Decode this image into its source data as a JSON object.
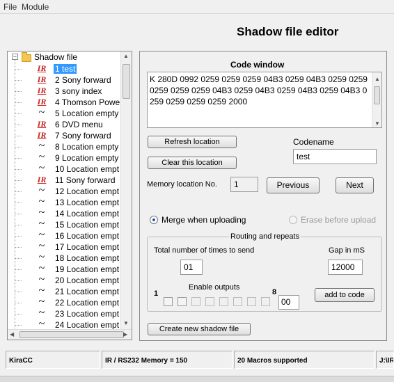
{
  "menu": {
    "file": "File",
    "module": "Module"
  },
  "title": "Shadow file editor",
  "tree": {
    "root_label": "Shadow file",
    "items": [
      {
        "type": "ir",
        "label": "1 test",
        "selected": true
      },
      {
        "type": "ir",
        "label": "2 Sony forward"
      },
      {
        "type": "ir",
        "label": "3 sony index"
      },
      {
        "type": "ir",
        "label": "4 Thomson Powe"
      },
      {
        "type": "empty",
        "label": "5 Location empty"
      },
      {
        "type": "ir",
        "label": "6 DVD menu"
      },
      {
        "type": "ir",
        "label": "7 Sony forward"
      },
      {
        "type": "empty",
        "label": "8 Location empty"
      },
      {
        "type": "empty",
        "label": "9 Location empty"
      },
      {
        "type": "empty",
        "label": "10 Location empt"
      },
      {
        "type": "ir",
        "label": "11 Sony forward"
      },
      {
        "type": "empty",
        "label": "12 Location empt"
      },
      {
        "type": "empty",
        "label": "13 Location empt"
      },
      {
        "type": "empty",
        "label": "14 Location empt"
      },
      {
        "type": "empty",
        "label": "15 Location empt"
      },
      {
        "type": "empty",
        "label": "16 Location empt"
      },
      {
        "type": "empty",
        "label": "17 Location empt"
      },
      {
        "type": "empty",
        "label": "18 Location empt"
      },
      {
        "type": "empty",
        "label": "19 Location empt"
      },
      {
        "type": "empty",
        "label": "20 Location empt"
      },
      {
        "type": "empty",
        "label": "21 Location empt"
      },
      {
        "type": "empty",
        "label": "22 Location empt"
      },
      {
        "type": "empty",
        "label": "23 Location empt"
      },
      {
        "type": "empty",
        "label": "24 Location empt"
      }
    ],
    "ir_glyph": "IR",
    "empty_glyph": "~"
  },
  "code_window": {
    "label": "Code window",
    "text": "K 280D 0992 0259 0259 0259 04B3 0259 04B3 0259 0259 0259 0259 0259 04B3 0259 04B3 0259 04B3 0259 04B3 0259 0259 0259 0259 2000"
  },
  "buttons": {
    "refresh": "Refresh location",
    "clear": "Clear this location",
    "previous": "Previous",
    "next": "Next",
    "add_to_code": "add to code",
    "create_new": "Create new shadow file"
  },
  "codename": {
    "label": "Codename",
    "value": "test"
  },
  "memory": {
    "label": "Memory location No.",
    "value": "1"
  },
  "options": {
    "merge": "Merge when uploading",
    "erase": "Erase before upload",
    "merge_selected": true
  },
  "routing": {
    "title": "Routing and repeats",
    "times_label": "Total number of times to send",
    "times_value": "01",
    "gap_label": "Gap in mS",
    "gap_value": "12000",
    "outputs_label": "Enable outputs",
    "outputs_start": "1",
    "outputs_end": "8",
    "outputs_value": "00",
    "outputs": [
      false,
      false,
      false,
      false,
      false,
      false,
      false,
      false
    ]
  },
  "status": {
    "app": "KiraCC",
    "memory": "IR / RS232 Memory = 150",
    "macros": "20 Macros supported",
    "extra": "J:\\IR"
  }
}
